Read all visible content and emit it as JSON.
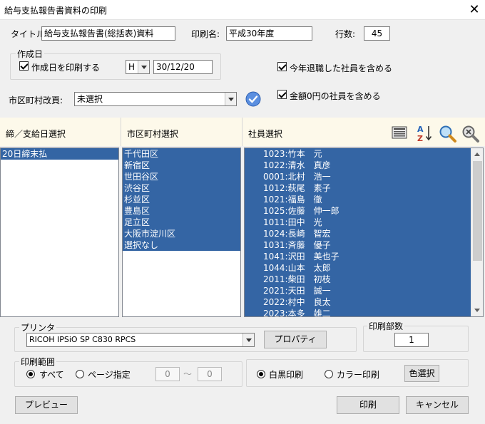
{
  "window": {
    "title": "給与支払報告書資料の印刷"
  },
  "header": {
    "title_label": "タイトル:",
    "title_value": "給与支払報告書(総括表)資料",
    "print_name_label": "印刷名:",
    "print_name_value": "平成30年度",
    "rows_label": "行数:",
    "rows_value": "45"
  },
  "creation_date": {
    "legend": "作成日",
    "print_checkbox_label": "作成日を印刷する",
    "era_value": "H",
    "date_value": "30/12/20"
  },
  "options": {
    "include_retired_label": "今年退職した社員を含める",
    "include_zero_label": "金額0円の社員を含める"
  },
  "municipality_page": {
    "label": "市区町村改頁:",
    "value": "未選択"
  },
  "panels": {
    "closing_header": "締／支給日選択",
    "municipality_header": "市区町村選択",
    "employee_header": "社員選択"
  },
  "closing_items": [
    "20日締末払"
  ],
  "municipality_items": [
    "千代田区",
    "新宿区",
    "世田谷区",
    "渋谷区",
    "杉並区",
    "豊島区",
    "足立区",
    "大阪市淀川区",
    "選択なし"
  ],
  "employees": [
    "1023:竹本　元",
    "1022:清水　真彦",
    "0001:北村　浩一",
    "1012:萩尾　素子",
    "1021:福島　徹",
    "1025:佐藤　伸一郎",
    "1011:田中　光",
    "1024:長崎　智宏",
    "1031:斉藤　優子",
    "1041:沢田　美也子",
    "1044:山本　太郎",
    "2011:柴田　初枝",
    "2021:天田　誠一",
    "2022:村中　良太",
    "2023:本多　雄二"
  ],
  "printer": {
    "legend": "プリンタ",
    "value": "RICOH IPSiO SP C830 RPCS",
    "properties_button": "プロパティ"
  },
  "copies": {
    "legend": "印刷部数",
    "value": "1"
  },
  "range": {
    "legend": "印刷範囲",
    "all_label": "すべて",
    "page_label": "ページ指定",
    "from_value": "0",
    "tilde": "～",
    "to_value": "0"
  },
  "color": {
    "mono_label": "白黒印刷",
    "color_label": "カラー印刷",
    "select_button": "色選択"
  },
  "footer": {
    "preview_button": "プレビュー",
    "print_button": "印刷",
    "cancel_button": "キャンセル"
  },
  "colors": {
    "selection": "#3465a4",
    "panel_header": "#fdf9ea",
    "dialog_bg": "#f0f0f0"
  }
}
